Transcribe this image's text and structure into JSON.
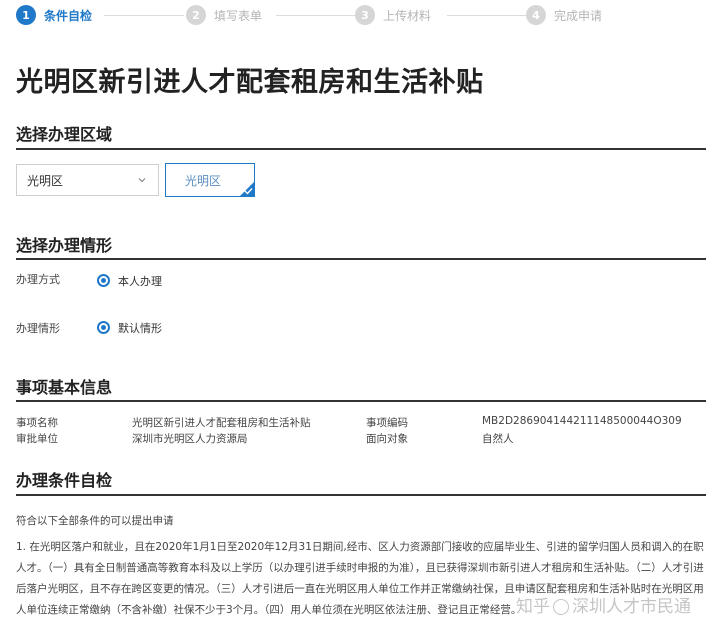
{
  "steps": [
    {
      "number": "1",
      "label": "条件自检"
    },
    {
      "number": "2",
      "label": "填写表单"
    },
    {
      "number": "3",
      "label": "上传材料"
    },
    {
      "number": "4",
      "label": "完成申请"
    }
  ],
  "page_title": "光明区新引进人才配套租房和生活补贴",
  "region_section": {
    "title": "选择办理区域",
    "select_value": "光明区",
    "chip_label": "光明区"
  },
  "situation_section": {
    "title": "选择办理情形",
    "method_label": "办理方式",
    "method_option": "本人办理",
    "situation_label": "办理情形",
    "situation_option": "默认情形"
  },
  "info_section": {
    "title": "事项基本信息",
    "item_name_label": "事项名称",
    "item_name_value": "光明区新引进人才配套租房和生活补贴",
    "item_code_label": "事项编码",
    "item_code_value": "MB2D286904144211148500044O309",
    "approval_label": "审批单位",
    "approval_value": "深圳市光明区人力资源局",
    "target_label": "面向对象",
    "target_value": "自然人"
  },
  "conditions_section": {
    "title": "办理条件自检",
    "intro": "符合以下全部条件的可以提出申请",
    "paragraph": "1. 在光明区落户和就业，且在2020年1月1日至2020年12月31日期间,经市、区人力资源部门接收的应届毕业生、引进的留学归国人员和调入的在职人才。（一）具有全日制普通高等教育本科及以上学历（以办理引进手续时申报的为准），且已获得深圳市新引进人才租房和生活补贴。（二）人才引进后落户光明区，且不存在跨区变更的情况。（三）人才引进后一直在光明区用人单位工作并正常缴纳社保，且申请区配套租房和生活补贴时在光明区用人单位连续正常缴纳（不含补缴）社保不少于3个月。（四）用人单位须在光明区依法注册、登记且正常经营。"
  },
  "watermark": {
    "text_a": "知乎",
    "text_b": "深圳人才市民通"
  },
  "colors": {
    "accent": "#1f78c8",
    "step_inactive": "#d6d6d6",
    "rule": "#333333"
  }
}
